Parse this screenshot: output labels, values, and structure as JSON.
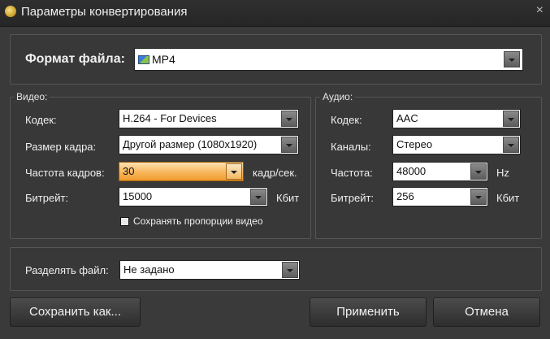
{
  "window": {
    "title": "Параметры конвертирования",
    "close": "×"
  },
  "format": {
    "label": "Формат файла:",
    "value": "MP4",
    "icon": "video-format-icon"
  },
  "video": {
    "group_label": "Видео:",
    "codec_label": "Кодек:",
    "codec_value": "H.264 - For Devices",
    "frame_size_label": "Размер кадра:",
    "frame_size_value": "Другой размер (1080x1920)",
    "fps_label": "Частота кадров:",
    "fps_value": "30",
    "fps_unit": "кадр/сек.",
    "bitrate_label": "Битрейт:",
    "bitrate_value": "15000",
    "bitrate_unit": "Кбит",
    "keep_aspect_label": "Сохранять пропорции видео"
  },
  "audio": {
    "group_label": "Аудио:",
    "codec_label": "Кодек:",
    "codec_value": "AAC",
    "channels_label": "Каналы:",
    "channels_value": "Стерео",
    "freq_label": "Частота:",
    "freq_value": "48000",
    "freq_unit": "Hz",
    "bitrate_label": "Битрейт:",
    "bitrate_value": "256",
    "bitrate_unit": "Кбит"
  },
  "split": {
    "label": "Разделять файл:",
    "value": "Не задано"
  },
  "buttons": {
    "save_as": "Сохранить как...",
    "apply": "Применить",
    "cancel": "Отмена"
  },
  "colors": {
    "background": "#3a3a3a",
    "highlight": "#f7b65c"
  }
}
